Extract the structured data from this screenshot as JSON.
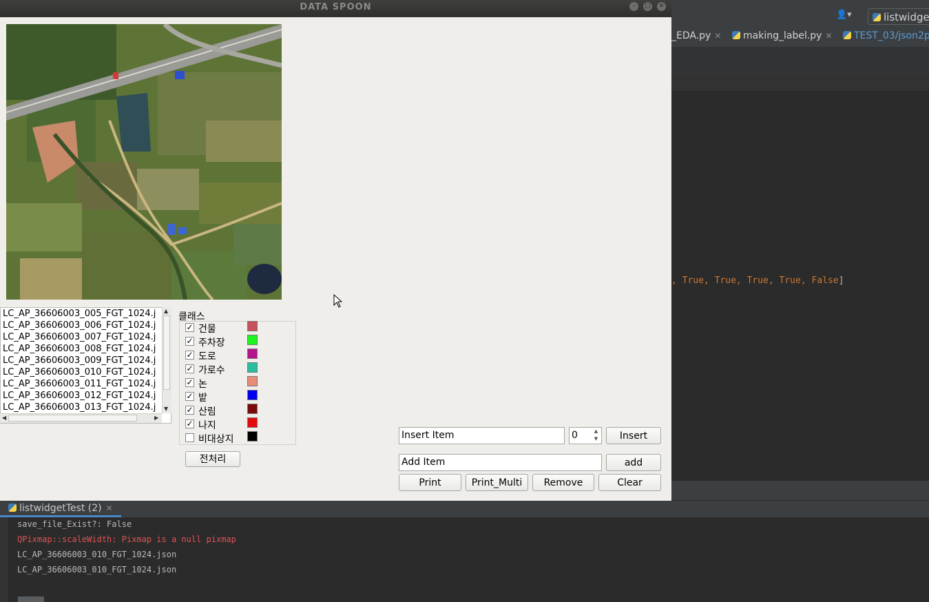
{
  "app": {
    "title": "DATA SPOON",
    "file_list": [
      "LC_AP_36606003_005_FGT_1024.j",
      "LC_AP_36606003_006_FGT_1024.j",
      "LC_AP_36606003_007_FGT_1024.j",
      "LC_AP_36606003_008_FGT_1024.j",
      "LC_AP_36606003_009_FGT_1024.j",
      "LC_AP_36606003_010_FGT_1024.j",
      "LC_AP_36606003_011_FGT_1024.j",
      "LC_AP_36606003_012_FGT_1024.j",
      "LC_AP_36606003_013_FGT_1024.j"
    ],
    "class_group": {
      "title": "클래스",
      "classes": [
        {
          "label": "건물",
          "checked": true,
          "color": "#c8505a"
        },
        {
          "label": "주차장",
          "checked": true,
          "color": "#1ef51e"
        },
        {
          "label": "도로",
          "checked": true,
          "color": "#b4148c"
        },
        {
          "label": "가로수",
          "checked": true,
          "color": "#28bea0"
        },
        {
          "label": "논",
          "checked": true,
          "color": "#e68c78"
        },
        {
          "label": "밭",
          "checked": true,
          "color": "#0000f0"
        },
        {
          "label": "산림",
          "checked": true,
          "color": "#780a0a"
        },
        {
          "label": "나지",
          "checked": true,
          "color": "#e60a0a"
        },
        {
          "label": "비대상지",
          "checked": false,
          "color": "#000000"
        }
      ],
      "check_mark": "✓"
    },
    "preprocess_button": "전처리",
    "insert_field": "Insert Item",
    "insert_index": "0",
    "insert_button": "Insert",
    "add_field": "Add Item",
    "add_button": "add",
    "print_button": "Print",
    "print_multi_button": "Print_Multi",
    "remove_button": "Remove",
    "clear_button": "Clear"
  },
  "ide": {
    "run_config": "listwidge",
    "tabs": [
      "_EDA.py",
      "making_label.py",
      "TEST_03/json2p"
    ],
    "code_line": ", True, True, True, True, False",
    "code_bracket": "]"
  },
  "run_panel": {
    "tab_label": "listwidgetTest (2)",
    "lines": [
      {
        "text": "save_file_Exist?: False",
        "error": false
      },
      {
        "text": "QPixmap::scaleWidth: Pixmap is a null pixmap",
        "error": true
      },
      {
        "text": "LC_AP_36606003_010_FGT_1024.json",
        "error": false
      },
      {
        "text": "LC_AP_36606003_010_FGT_1024.json",
        "error": false
      }
    ]
  }
}
